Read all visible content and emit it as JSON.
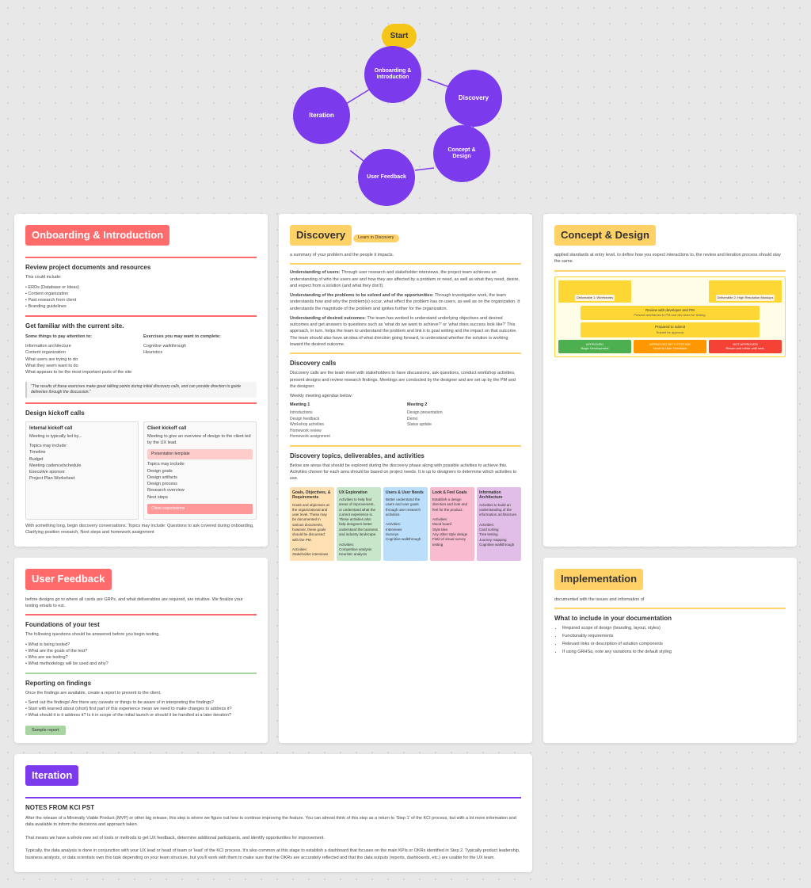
{
  "flowchart": {
    "start_label": "Start",
    "nodes": [
      {
        "id": "onboarding",
        "label": "Onboarding &\nIntroduction"
      },
      {
        "id": "discovery",
        "label": "Discovery"
      },
      {
        "id": "concept",
        "label": "Concept &\nDesign"
      },
      {
        "id": "user_feedback",
        "label": "User Feedback"
      },
      {
        "id": "iteration",
        "label": "Iteration"
      }
    ]
  },
  "cards": {
    "onboarding": {
      "title": "Onboarding & Introduction",
      "subtitle": "Review project documents and resources",
      "content_intro": "This could include:",
      "list_items": [
        "ERDs (Database or Ideas)",
        "Content organization",
        "Past research from client",
        "Branding guidelines"
      ],
      "section2": "Get familiar with the current site.",
      "left_col_title": "Some things to pay attention to:",
      "left_items": [
        "Information architecture",
        "Content organization",
        "What users are trying to do",
        "What they seem want to do",
        "What appears to be the most important parts of the site"
      ],
      "right_col_title": "Exercises you may want to complete:",
      "right_items": [
        "Cognitive walkthrough",
        "Heuristics"
      ],
      "quote": "\"The results of these exercises make great talking points during initial discovery calls, and can provide direction to guide deliveries through the discussion.\"",
      "section3": "Design kickoff calls",
      "internal_kickoff_title": "Internal kickoff call",
      "internal_kickoff_text": "Meeting is typically led by...",
      "internal_topics": [
        "Topics may include:",
        "Timeline",
        "Budget",
        "Meeting cadence/schedule",
        "Executive sponsor",
        "Project Plan Worksheet"
      ],
      "client_kickoff_title": "Client kickoff call",
      "client_kickoff_text": "Meeting to give an overview of design to the client led by the UX lead.",
      "client_topics": [
        "Topics may include:",
        "Design goals",
        "Design artifacts",
        "Design process",
        "Research overview",
        "Next steps"
      ],
      "pink_box": "Presentation template",
      "salmon_box": "Client expectations",
      "footer_text": "With something long, begin discovery conversations. Topics may include: Questions to ask covered during onboarding, Clarifying position research, Next steps and homework assignment"
    },
    "discovery": {
      "title": "Discovery",
      "tag": "Learn in Discovery",
      "intro": "a summary of your problem and the people it impacts.",
      "bullet_points": [
        "Understanding of users: Through user research and stakeholder interviews, the project team achieves an understanding of who the users are and how they are affected by a problem or need, as well as what they need, desire, and expect from a solution (and what they don't).",
        "Understanding of the problems to be solved and of the opportunities: Through investigation work, the team understands how and why the problem(s) occur, what effect the problem has on users, as well as on the organization. It understands the magnitude of the problem and ignites further for the organization.",
        "Understanding of desired outcomes: The team has worked to understand underlying objectives and desired outcomes and get answers to questions such as 'what do we want to achieve?' or 'what does success look like?' This approach, in turn, helps the team to understand the problem and link it to goal setting and the impact on that outcome. The team should also have an idea of what direction going forward, to understand whether the solution is working toward the desired outcome."
      ],
      "discovery_calls_title": "Discovery calls",
      "discovery_calls_text": "Discovery calls are the team meet with stakeholders to have discussions, ask questions, conduct workshop activities, present designs and review research findings. Meetings are conducted by the designer and are set up by the PM and the designer.",
      "meeting_agenda": "Weekly meeting agendas below:",
      "meeting1_title": "Meeting 1",
      "meeting1_items": [
        "Introductions",
        "Design feedback",
        "Workshop activities",
        "Homework review",
        "Homework assignment"
      ],
      "meeting2_title": "Meeting 2",
      "meeting2_items": [
        "Design presentation",
        "Demo",
        "Status update"
      ],
      "section3": "Discovery topics, deliverables, and activities",
      "section3_text": "Below are areas that should be explored during the discovery phase along with possible activities to achieve this. Activities chosen for each area should be based on project needs. It is up to designers to determine which activities to use.",
      "columns": [
        {
          "title": "Goals, Objectives, & Requirements",
          "color": "bg-orange",
          "description": "Goals and objectives at the organizational and user level. These may be documented in various documents, however, these goals should be discussed with the PM.",
          "activities": [
            "Stakeholder interviews"
          ]
        },
        {
          "title": "UX Exploration",
          "color": "bg-green",
          "description": "Activities to help find areas of improvement, or understand what the current experience is. These activities also help designers better understand the business and industry landscape.",
          "activities": [
            "Competitive analysis",
            "Heuristic analysis"
          ]
        },
        {
          "title": "Users & User Needs",
          "color": "bg-blue",
          "description": "Better understand the users and user goals through user research activities.",
          "activities": [
            "Interviews",
            "Surveys",
            "Cognitive walkthrough"
          ]
        },
        {
          "title": "Look & Feel Goals",
          "color": "bg-pink",
          "description": "Establish a design direction and look and feel for the product.",
          "activities": [
            "Mood board",
            "Style tiles",
            "Any other style design",
            "Field of visual survey testing"
          ]
        },
        {
          "title": "Information Architecture",
          "color": "bg-purple-light",
          "description": "Activities to build an understanding of the information architecture.",
          "activities": [
            "Card sorting",
            "Tree testing",
            "Journey mapping",
            "Cognitive walkthrough"
          ]
        }
      ]
    },
    "concept": {
      "title": "Concept & Design",
      "subtitle": "applied standards at entry level, to define how you expect interactions to, the review and iteration process should stay the same.",
      "wireframe_label": "Deliverable 1: Wireframes",
      "wireframe_label2": "Deliverable 2: High Resolution Mockups",
      "approved_label": "APPROVED\nBegin Development",
      "approved_testing_label": "APPROVED WITH TESTING\nMove to User Feedback",
      "not_approved_label": "NOT APPROVED\nReturn and refine until next.",
      "review_label": "Review with developer and PM\nPresent wireframes to PM and dev team for testing.",
      "prepared_label": "Prepared to submit\nSubmit for approval"
    },
    "user_feedback": {
      "title": "User Feedback",
      "subtitle": "before designs go to where all cards are GRPs, and what deliverables are required, are intuitive. We finalize your testing emails to est.",
      "section1": "Foundations of your test",
      "foundations_text": "The following questions should be answered before you begin testing.",
      "questions": [
        "• What is being tested?",
        "• What are the goals of the test?",
        "• Who are we testing?",
        "• What methodology will be used and why?"
      ],
      "section2": "Reporting on findings",
      "reporting_text": "Once the findings are available, create a report to present to the client.",
      "reporting_items": [
        "• Send out the findings! Are there any caveats or things to be aware of in interpreting the findings?",
        "• Start with learned about (short) first part of this experience mean we need to make changes to address it?",
        "• What should it is it address it? Is it in scope of the initial launch or should it be handled at a later iteration?"
      ],
      "sample_report": "Sample report"
    },
    "implementation": {
      "title": "Implementation",
      "subtitle": "documented with the issues and information of",
      "section1": "What to include in your documentation",
      "list_items": [
        "Required scope of design (branding, layout, styles)",
        "Functionality requirements",
        "Relevant links or description of solution components",
        "If using GRHSa, note any variations to the default styling"
      ]
    },
    "iteration": {
      "title": "Iteration",
      "notes_title": "NOTES FROM KCI PST",
      "notes_text": "After the release of a Minimally Viable Product (MVP) or other big release, this step is where we figure out how to continue improving the feature. You can almost think of this step as a return to 'Step 1' of the KCI process, but with a lot more information and data available to inform the decisions and approach taken.\n\nThat means we have a whole new set of tools or methods to get UX feedback, determine additional participants, and identify opportunities for improvement.\n\nTypically, the data analysis is done in conjunction with your UX lead or head of team or 'lead' of the KCI process. It's also common at this stage to establish a dashboard that focuses on the main KPIs or OKRs identified in Step 2. Typically product leadership, business analysts, or data scientists own this task depending on your team structure, but you'll work with them to make sure that the OKRs are accurately reflected and that the data outputs (reports, dashboards, etc.) are usable for the UX team."
    }
  }
}
